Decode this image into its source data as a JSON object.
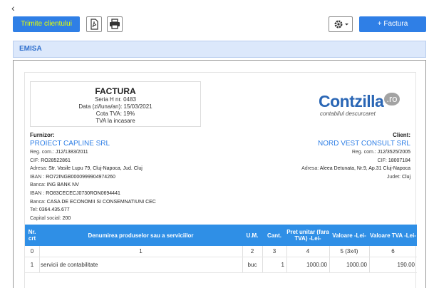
{
  "nav": {
    "back_glyph": "‹"
  },
  "toolbar": {
    "send_label": "Trimite clientului",
    "pdf_icon": "pdf-icon",
    "print_icon": "printer-icon",
    "settings_icon": "gear-icon",
    "new_invoice_label": "+ Factura"
  },
  "section": {
    "label": "EMISA"
  },
  "invoice": {
    "title": "FACTURA",
    "series": "Seria H nr. 0483",
    "date": "Data (zi/luna/an): 15/03/2021",
    "vat_rate": "Cota TVA: 19%",
    "vat_mode": "TVA la incasare"
  },
  "logo": {
    "main": "Contzilla",
    "suffix": ".ro",
    "tagline": "contabilul descurcaret"
  },
  "supplier": {
    "heading": "Furnizor:",
    "name": "PROIECT CAPLINE SRL",
    "reg_label": "Reg. com.:",
    "reg": "J12/1383/2011",
    "cif_label": "CIF:",
    "cif": "RO28522861",
    "address_label": "Adresa:",
    "address": "Str. Vasile Lupu 79, Cluj-Napoca, Jud. Cluj",
    "iban1_label": "IBAN :",
    "iban1": "RO72INGB0000999904974260",
    "bank1_label": "Banca:",
    "bank1": "ING BANK NV",
    "iban2_label": "IBAN :",
    "iban2": "RO83CECECJ0730RON0694441",
    "bank2_label": "Banca:",
    "bank2": "CASA DE ECONOMII SI CONSEMNATIUNI CEC",
    "tel_label": "Tel:",
    "tel": "0364.435.677",
    "capital_label": "Capital social:",
    "capital": "200"
  },
  "client": {
    "heading": "Client:",
    "name": "NORD VEST CONSULT SRL",
    "reg_label": "Reg. com.:",
    "reg": "J12/3525/2005",
    "cif_label": "CIF:",
    "cif": "18007184",
    "address_label": "Adresa:",
    "address": "Aleea Detunata, Nr.9, Ap.31 Cluj-Napoca",
    "county_label": "Judet:",
    "county": "Cluj"
  },
  "table": {
    "headers": {
      "nr": "Nr. crt",
      "desc": "Denumirea produselor sau a serviciilor",
      "um": "U.M.",
      "qty": "Cant.",
      "price": "Pret unitar (fara TVA) -Lei-",
      "value": "Valoare -Lei-",
      "vat": "Valoare TVA -Lei-"
    },
    "index_row": {
      "nr": "0",
      "desc": "1",
      "um": "2",
      "qty": "3",
      "price": "4",
      "value": "5 (3x4)",
      "vat": "6"
    },
    "rows": [
      {
        "nr": "1",
        "desc": "servicii de contabilitate",
        "um": "buc",
        "qty": "1",
        "price": "1000.00",
        "value": "1000.00",
        "vat": "190.00"
      }
    ]
  }
}
